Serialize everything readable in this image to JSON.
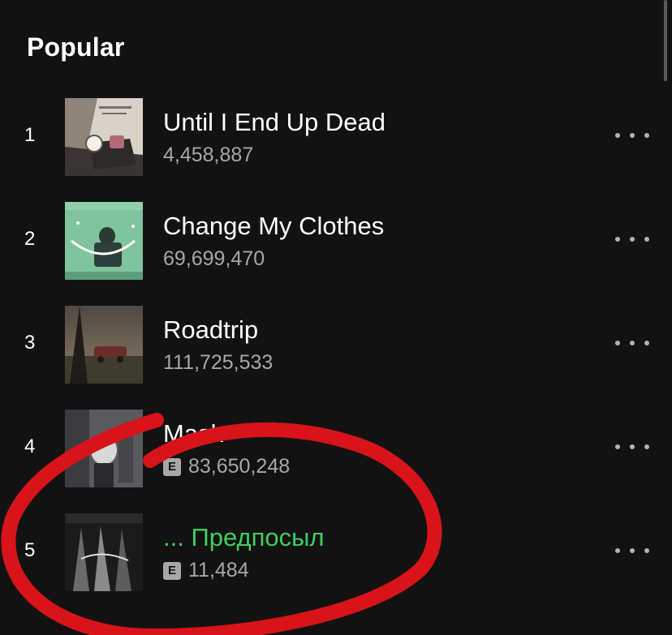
{
  "section": {
    "title": "Popular"
  },
  "tracks": [
    {
      "rank": "1",
      "title": "Until I End Up Dead",
      "plays": "4,458,887",
      "explicit": false,
      "playing": false,
      "explicit_label": ""
    },
    {
      "rank": "2",
      "title": "Change My Clothes",
      "plays": "69,699,470",
      "explicit": false,
      "playing": false,
      "explicit_label": ""
    },
    {
      "rank": "3",
      "title": "Roadtrip",
      "plays": "111,725,533",
      "explicit": false,
      "playing": false,
      "explicit_label": ""
    },
    {
      "rank": "4",
      "title": "Mask",
      "plays": "83,650,248",
      "explicit": true,
      "playing": false,
      "explicit_label": "E"
    },
    {
      "rank": "5",
      "title": "... Предпосыл",
      "plays": "11,484",
      "explicit": true,
      "playing": true,
      "explicit_label": "E"
    }
  ],
  "colors": {
    "background": "#121212",
    "text_primary": "#ffffff",
    "text_secondary": "#a7a7a7",
    "playing_accent": "#3fce5f",
    "annotation_red": "#d8141a"
  },
  "icons": {
    "more": "more-options-icon",
    "explicit": "explicit-badge"
  }
}
